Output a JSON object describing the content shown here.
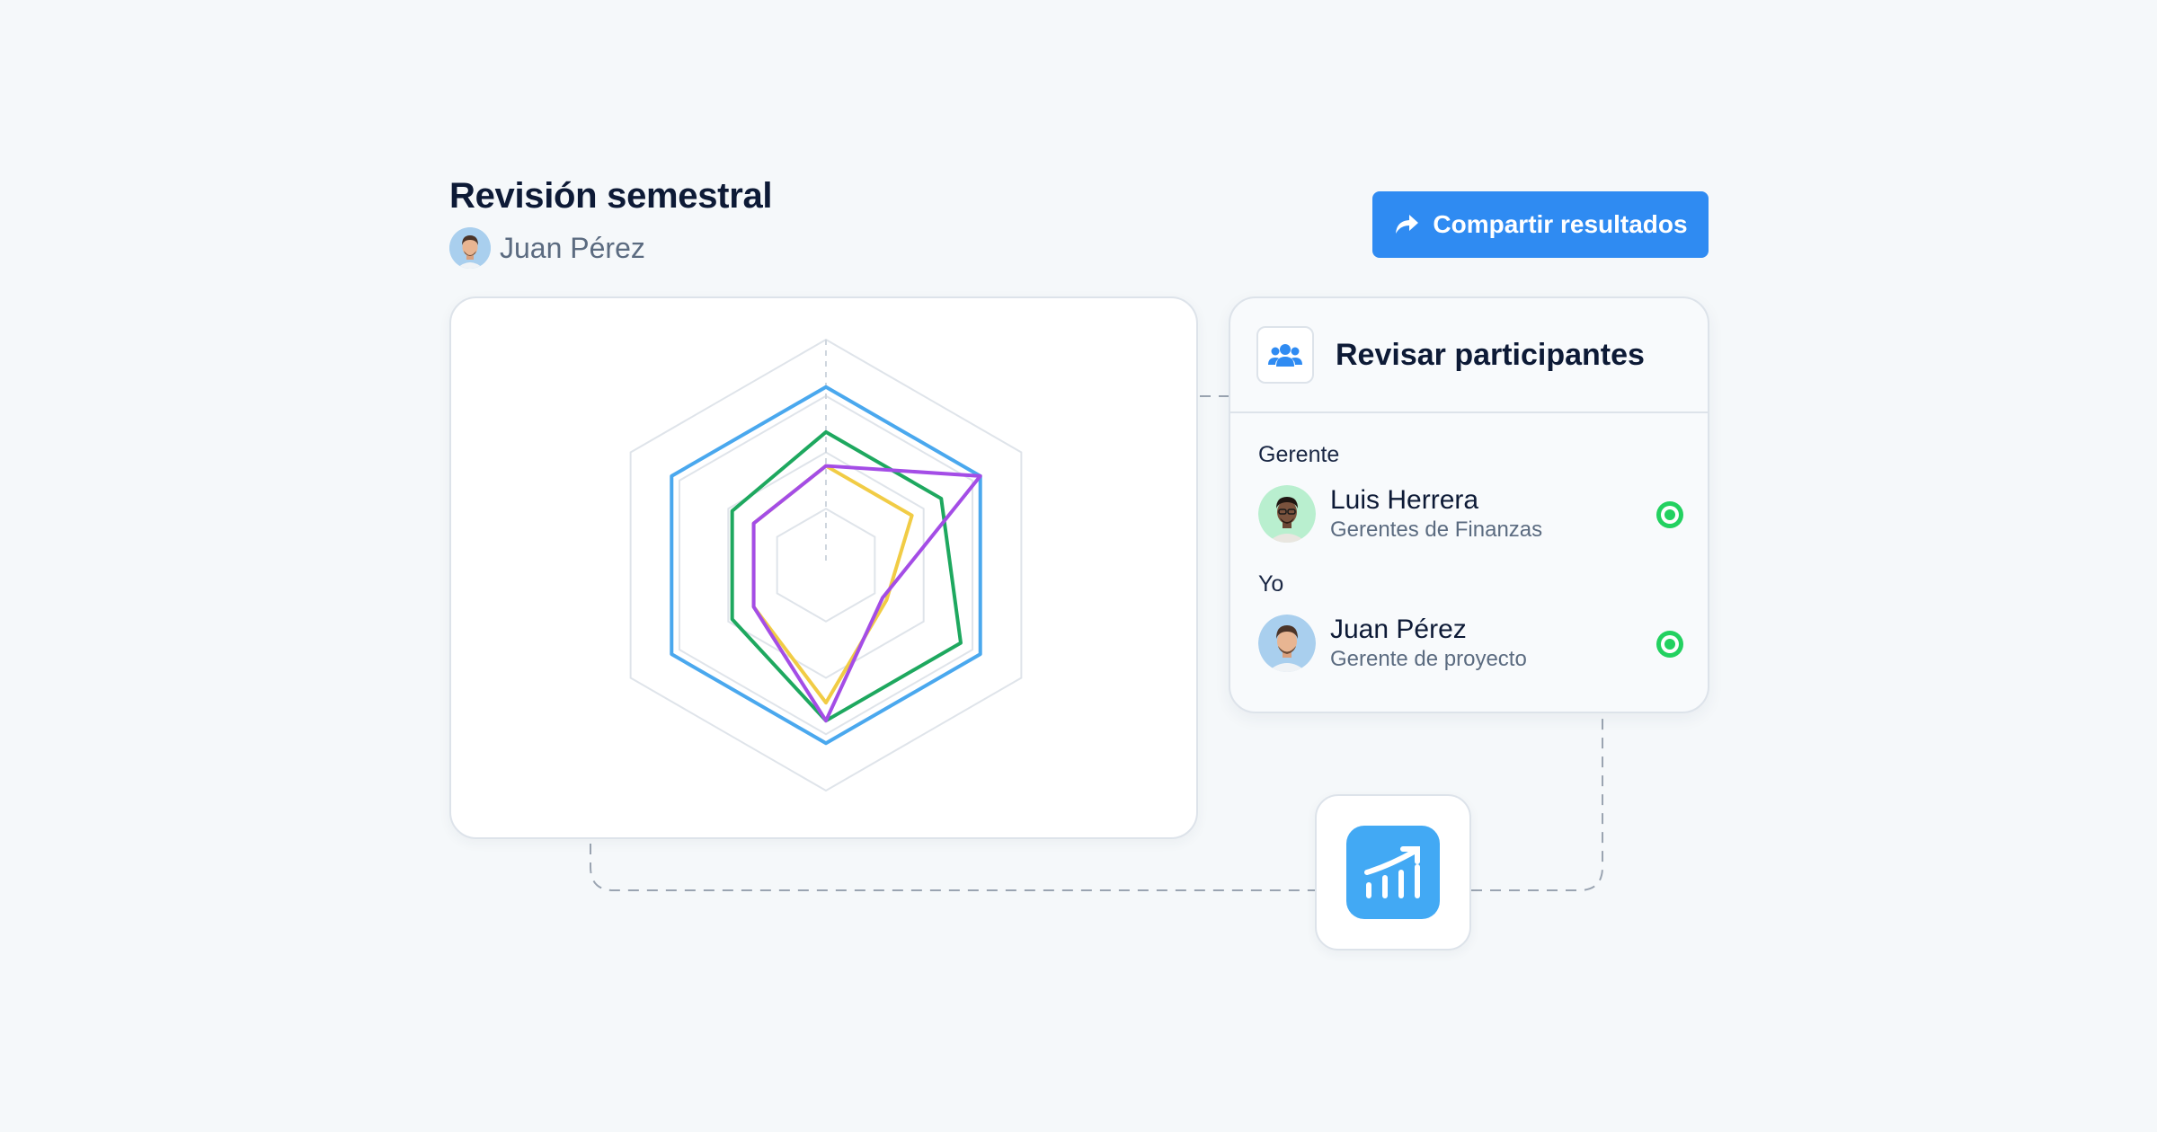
{
  "header": {
    "title": "Revisión semestral",
    "user_name": "Juan Pérez",
    "share_button": "Compartir resultados"
  },
  "participants": {
    "title": "Revisar participantes",
    "groups": [
      {
        "label": "Gerente",
        "person": {
          "name": "Luis Herrera",
          "role": "Gerentes de Finanzas",
          "status": "active"
        }
      },
      {
        "label": "Yo",
        "person": {
          "name": "Juan Pérez",
          "role": "Gerente de proyecto",
          "status": "active"
        }
      }
    ]
  },
  "icons": {
    "share": "share-arrow-icon",
    "participants": "users-icon",
    "status": "status-dot-icon",
    "analytics": "chart-growth-icon"
  },
  "colors": {
    "accent": "#2f8bf2",
    "status_active": "#23d160",
    "analytics_tile": "#42a9f4"
  },
  "chart_data": {
    "type": "radar",
    "axes": 6,
    "rings": 4,
    "max": 1,
    "series": [
      {
        "color": "#4aa8ee",
        "values": [
          0.79,
          0.79,
          0.79,
          0.79,
          0.79,
          0.79
        ]
      },
      {
        "color": "#1ea85f",
        "values": [
          0.59,
          0.59,
          0.69,
          0.69,
          0.48,
          0.48
        ]
      },
      {
        "color": "#f1cc45",
        "values": [
          0.44,
          0.44,
          0.31,
          0.61,
          0.37,
          0.37
        ]
      },
      {
        "color": "#a44de6",
        "values": [
          0.44,
          0.79,
          0.29,
          0.69,
          0.37,
          0.37
        ]
      }
    ]
  }
}
